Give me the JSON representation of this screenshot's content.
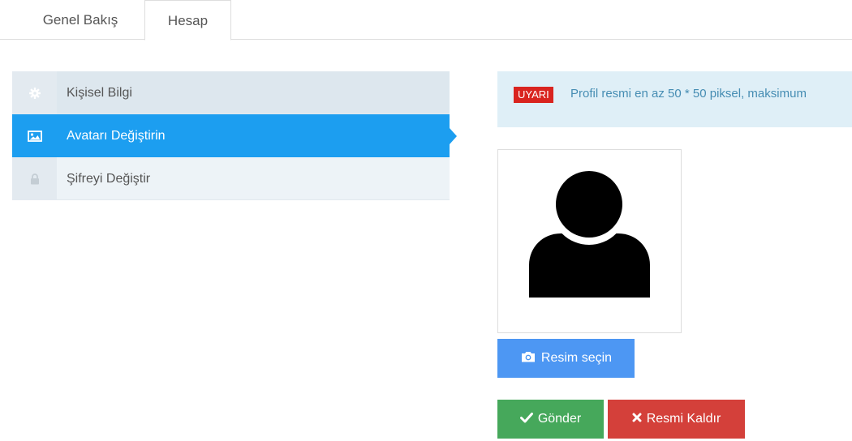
{
  "tabs": [
    {
      "label": "Genel Bakış"
    },
    {
      "label": "Hesap"
    }
  ],
  "menu": {
    "items": [
      {
        "label": "Kişisel Bilgi",
        "icon": "gear-icon"
      },
      {
        "label": "Avatarı Değiştirin",
        "icon": "image-icon"
      },
      {
        "label": "Şifreyi Değiştir",
        "icon": "lock-icon"
      }
    ]
  },
  "alert": {
    "badge": "UYARI",
    "text": "Profil resmi en az 50 * 50 piksel, maksimum"
  },
  "avatar": {
    "icon": "user-silhouette-icon"
  },
  "buttons": {
    "select": "Resim seçin",
    "send": "Gönder",
    "remove": "Resmi Kaldır"
  },
  "colors": {
    "active": "#1c9ef0",
    "select": "#4d97f3",
    "send": "#46a85b",
    "remove": "#d4403a",
    "badge": "#d9241f"
  }
}
